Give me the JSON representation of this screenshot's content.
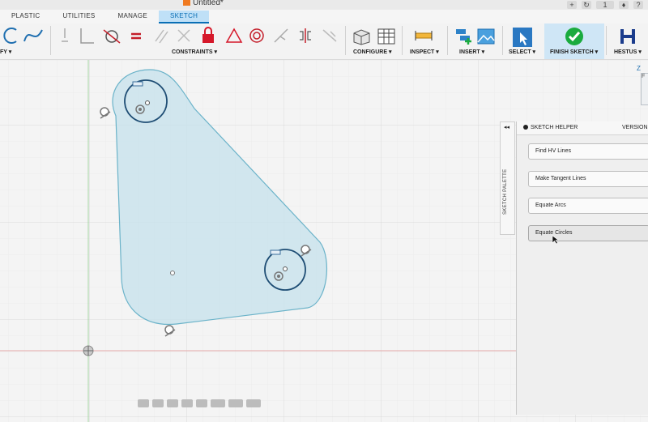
{
  "window": {
    "title": "Untitled*",
    "notification_count": "1"
  },
  "tabs": [
    "PLASTIC",
    "UTILITIES",
    "MANAGE",
    "SKETCH"
  ],
  "active_tab": "SKETCH",
  "ribbon": {
    "groups": {
      "modify": "FY ▾",
      "constraints": "CONSTRAINTS ▾",
      "configure": "CONFIGURE ▾",
      "inspect": "INSPECT ▾",
      "insert": "INSERT ▾",
      "select": "SELECT ▾",
      "finish_sketch": "FINISH SKETCH ▾",
      "hestus": "HESTUS ▾"
    }
  },
  "viewcube": {
    "axis_label": "Z",
    "face_label": "F"
  },
  "palette": {
    "side_tab_label": "SKETCH PALETTE",
    "collapse_glyph": "◂◂",
    "header": "SKETCH HELPER",
    "version_label": "VERSION",
    "buttons": [
      "Find HV Lines",
      "Make Tangent Lines",
      "Equate Arcs",
      "Equate Circles"
    ],
    "hovered_button": "Equate Circles"
  },
  "colors": {
    "accent": "#0a6fb5",
    "sketch_fill": "#c6e2ec",
    "sketch_line": "#1e4d74",
    "finish_check": "#1aab3e",
    "grid": "#e2e2e2"
  }
}
